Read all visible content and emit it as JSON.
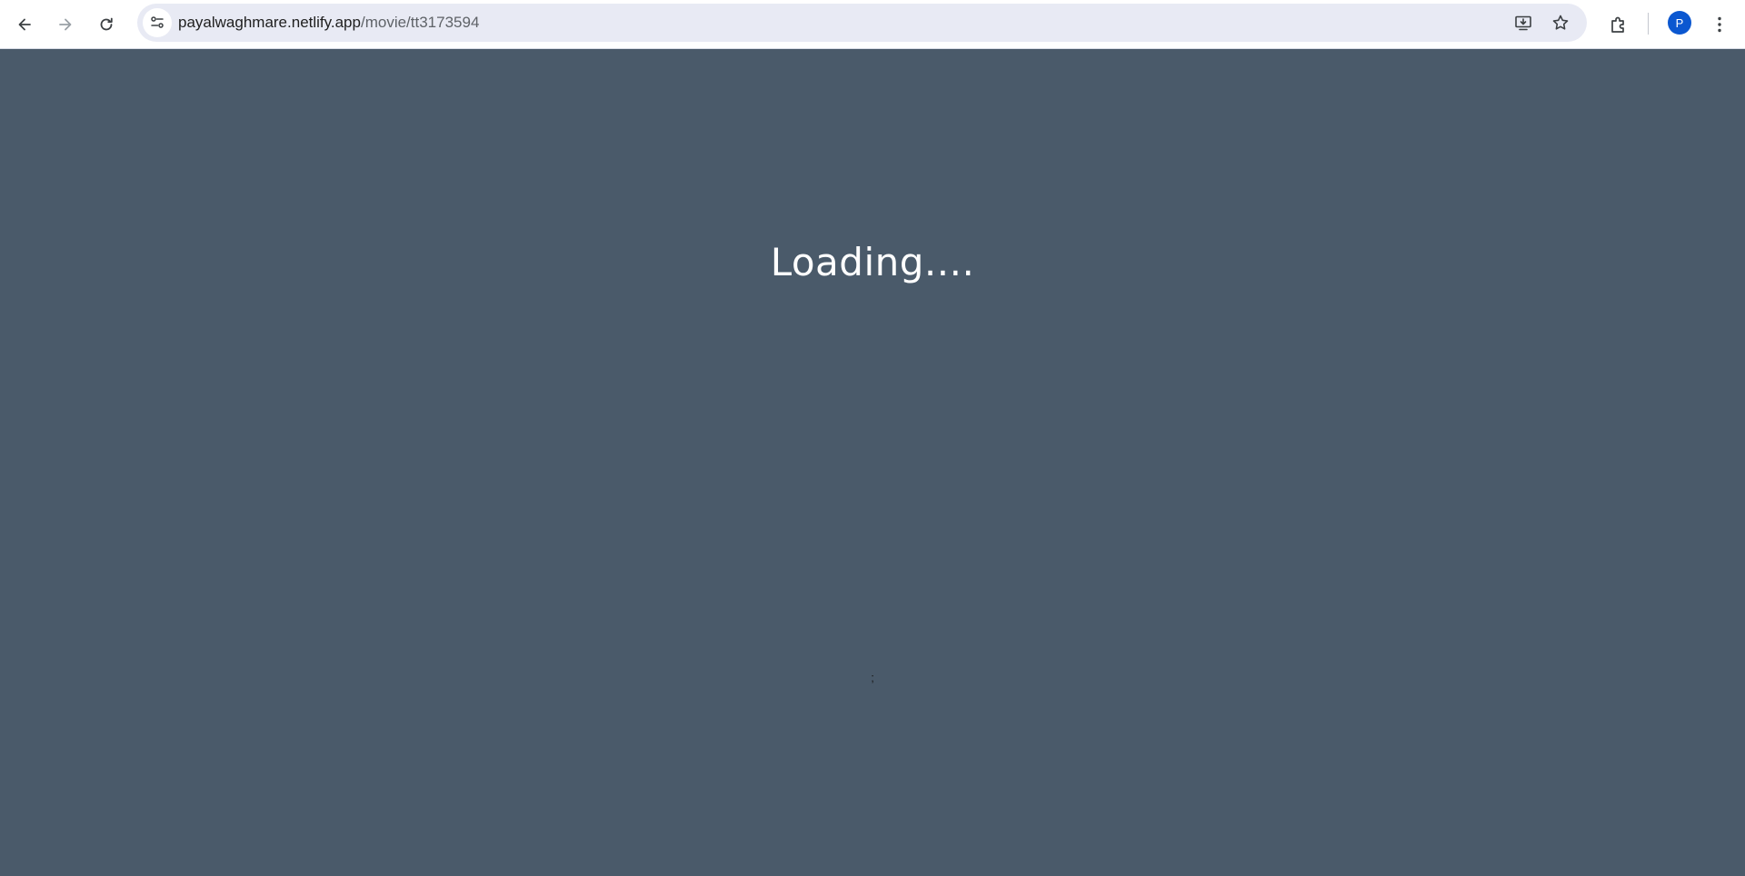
{
  "browser": {
    "url_host": "payalwaghmare.netlify.app",
    "url_path": "/movie/tt3173594",
    "profile_initial": "P",
    "icons": {
      "back": "arrow-left-icon",
      "forward": "arrow-right-icon",
      "reload": "reload-icon",
      "site_info": "tune-icon",
      "install": "install-app-icon",
      "bookmark": "star-icon",
      "extensions": "puzzle-icon",
      "menu": "kebab-menu-icon"
    }
  },
  "page": {
    "loading_text": "Loading....",
    "stray_text": ";",
    "background_color": "#4a5a6a",
    "text_color": "#ffffff"
  }
}
